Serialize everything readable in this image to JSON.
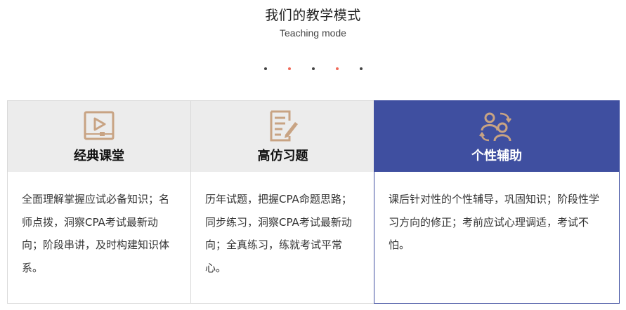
{
  "header": {
    "title": "我们的教学模式",
    "subtitle": "Teaching mode"
  },
  "colors": {
    "accent": "#3f4fa0",
    "icon": "#c8a383",
    "dot_accent": "#f06a5a"
  },
  "cards": [
    {
      "icon": "video-play-icon",
      "title": "经典课堂",
      "desc": "全面理解掌握应试必备知识；名师点拨，洞察CPA考试最新动向；阶段串讲，及时构建知识体系。"
    },
    {
      "icon": "document-pen-icon",
      "title": "高仿习题",
      "desc": "历年试题，把握CPA命题思路；同步练习，洞察CPA考试最新动向；全真练习，练就考试平常心。"
    },
    {
      "icon": "users-exchange-icon",
      "title": "个性辅助",
      "desc": "课后针对性的个性辅导，巩固知识；阶段性学习方向的修正；考前应试心理调适，考试不怕。"
    }
  ]
}
